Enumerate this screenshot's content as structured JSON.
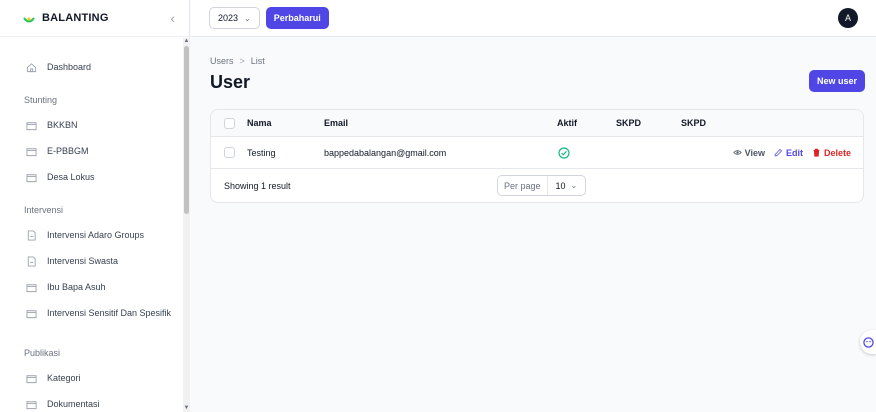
{
  "app": {
    "brand": "BALANTING"
  },
  "topbar": {
    "year": "2023",
    "update_label": "Perbaharui",
    "avatar_initial": "A"
  },
  "sidebar": {
    "dashboard": "Dashboard",
    "groups": [
      {
        "label": "Stunting",
        "items": [
          "BKKBN",
          "E-PBBGM",
          "Desa Lokus"
        ]
      },
      {
        "label": "Intervensi",
        "items": [
          "Intervensi Adaro Groups",
          "Intervensi Swasta",
          "Ibu Bapa Asuh",
          "Intervensi Sensitif Dan Spesifik"
        ]
      },
      {
        "label": "Publikasi",
        "items": [
          "Kategori",
          "Dokumentasi"
        ]
      }
    ]
  },
  "breadcrumb": {
    "parent": "Users",
    "separator": ">",
    "current": "List"
  },
  "page": {
    "title": "User",
    "new_button": "New user"
  },
  "table": {
    "headers": {
      "nama": "Nama",
      "email": "Email",
      "aktif": "Aktif",
      "skpd1": "SKPD",
      "skpd2": "SKPD"
    },
    "rows": [
      {
        "nama": "Testing",
        "email": "bappedabalangan@gmail.com",
        "aktif": true,
        "skpd1": "",
        "skpd2": ""
      }
    ],
    "actions": {
      "view": "View",
      "edit": "Edit",
      "delete": "Delete"
    },
    "footer": {
      "showing": "Showing 1 result",
      "per_page_label": "Per page",
      "per_page_value": "10"
    }
  },
  "colors": {
    "accent": "#4f46e5",
    "danger": "#dc2626",
    "success": "#10b981"
  }
}
